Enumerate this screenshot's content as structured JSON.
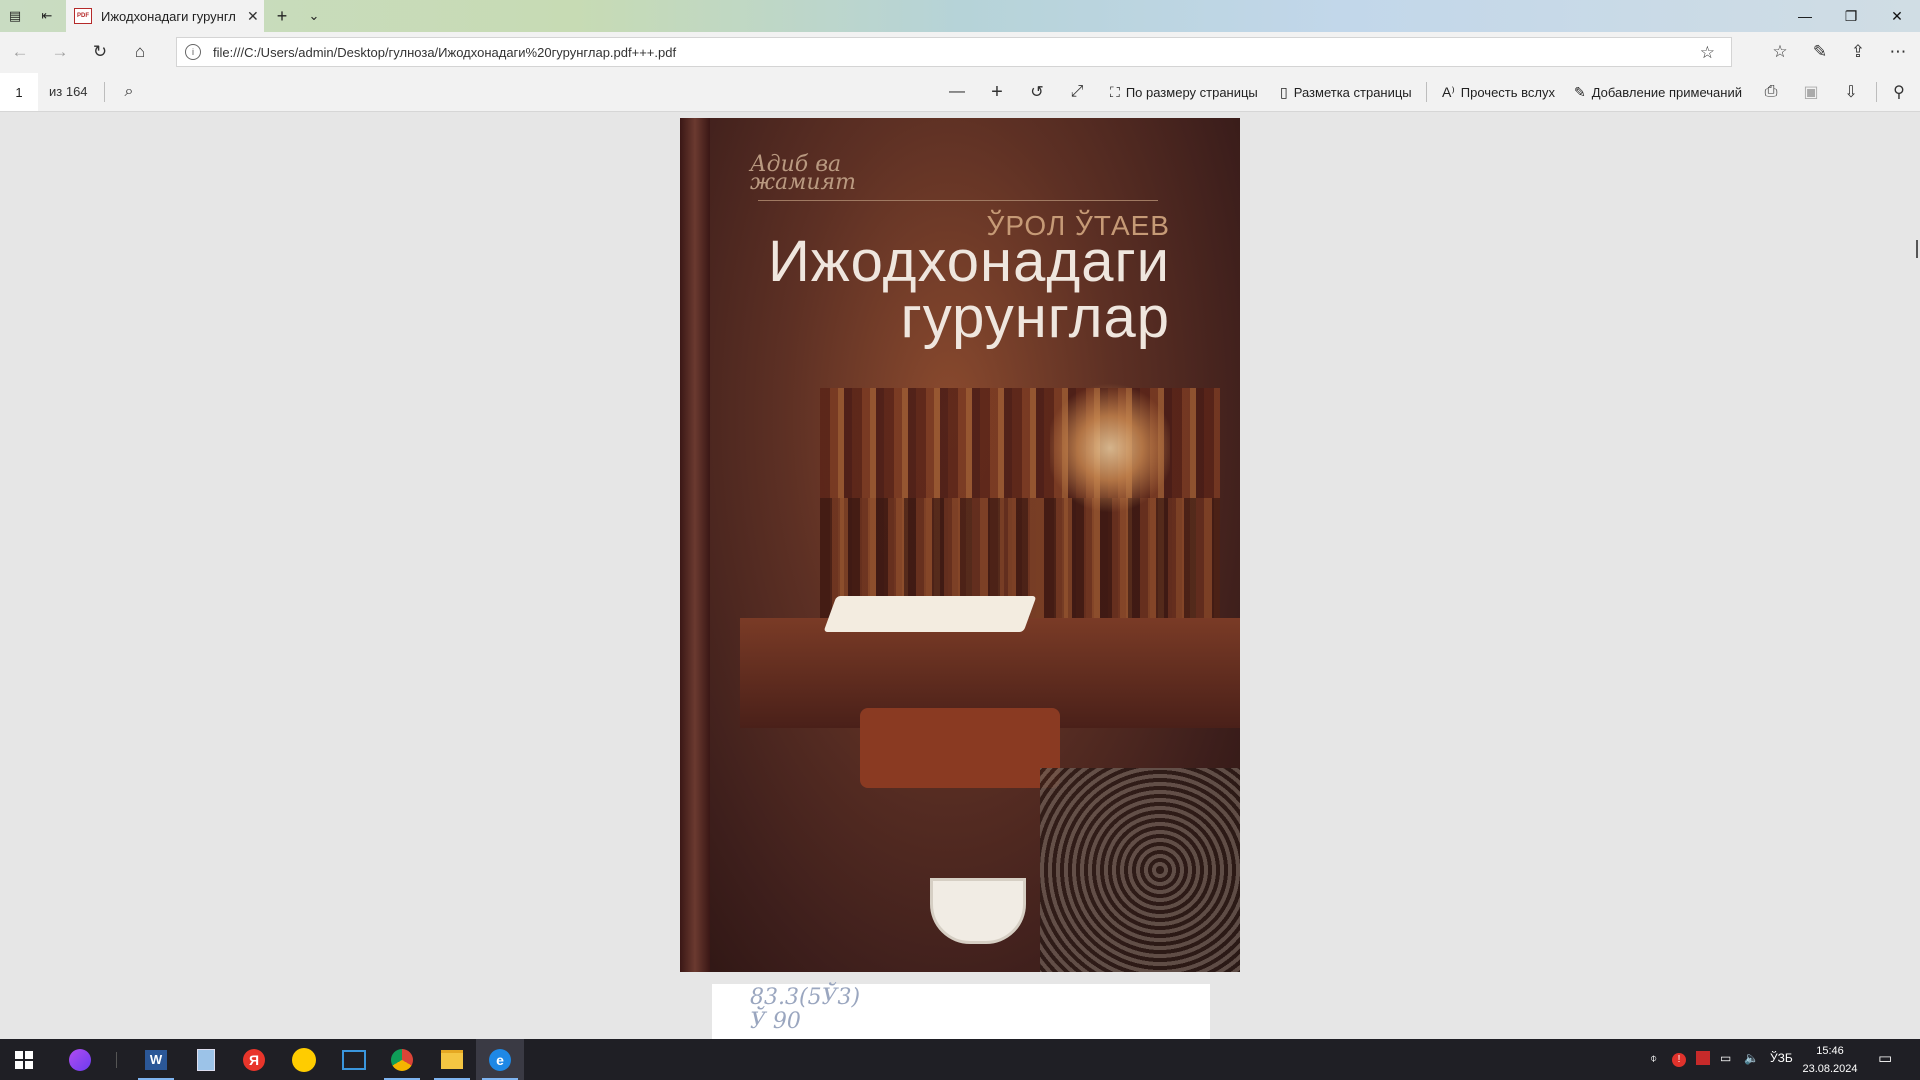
{
  "browser": {
    "tab": {
      "title": "Ижодхонадаги гурунгл",
      "icon": "pdf-file-icon"
    },
    "address": {
      "url": "file:///C:/Users/admin/Desktop/гулноза/Ижодхонадаги%20гурунглар.pdf+++.pdf"
    }
  },
  "pdf_toolbar": {
    "page_current": "1",
    "page_total": "из 164",
    "fit_page": "По размеру страницы",
    "page_layout": "Разметка страницы",
    "read_aloud": "Прочесть вслух",
    "add_notes": "Добавление примечаний"
  },
  "document": {
    "cover": {
      "series": "Адиб ва жамият",
      "author": "ЎРОЛ ЎТАЕВ",
      "title_line1": "Ижодхонадаги",
      "title_line2": "гурунглар"
    },
    "page2_handwriting": "83.3(5Ў3)\nЎ 90"
  },
  "taskbar": {
    "language": "ЎЗБ",
    "time": "15:46",
    "date": "23.08.2024"
  },
  "colors": {
    "accent": "#0078d7",
    "cover_dark": "#3e1f1c",
    "title_text": "#efe6de"
  }
}
